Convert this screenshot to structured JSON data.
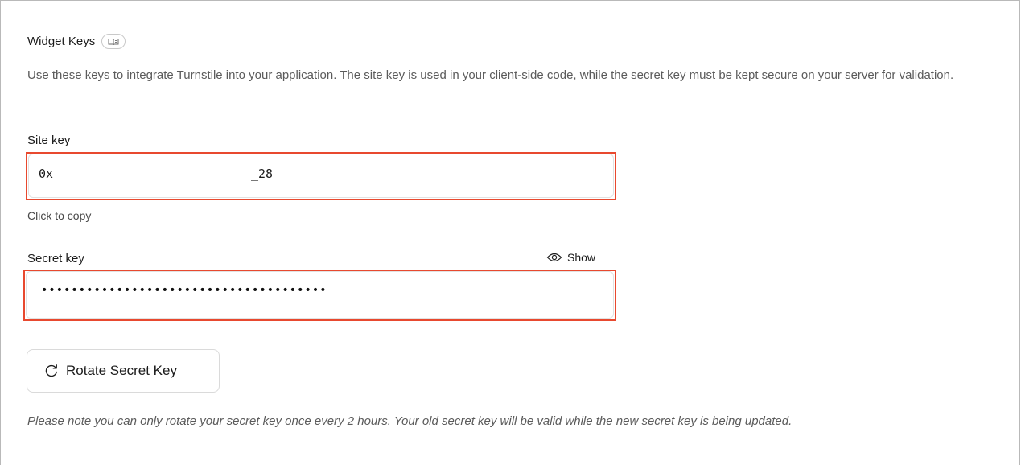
{
  "widget_keys": {
    "heading": "Widget Keys",
    "docs_icon": "book-icon",
    "description": "Use these keys to integrate Turnstile into your application. The site key is used in your client-side code, while the secret key must be kept secure on your server for validation."
  },
  "site_key": {
    "label": "Site key",
    "value_start": "0x",
    "value_end": "_28",
    "helper": "Click to copy"
  },
  "secret_key": {
    "label": "Secret key",
    "show_label": "Show",
    "show_icon": "eye-icon",
    "masked_value": "••••••••••••••••••••••••••••••••••••••"
  },
  "rotate": {
    "button_label": "Rotate Secret Key",
    "icon": "refresh-icon",
    "note": "Please note you can only rotate your secret key once every 2 hours. Your old secret key will be valid while the new secret key is being updated."
  },
  "colors": {
    "highlight": "#e8492f",
    "text": "#1c1c1c",
    "muted": "#5b5b5b"
  }
}
